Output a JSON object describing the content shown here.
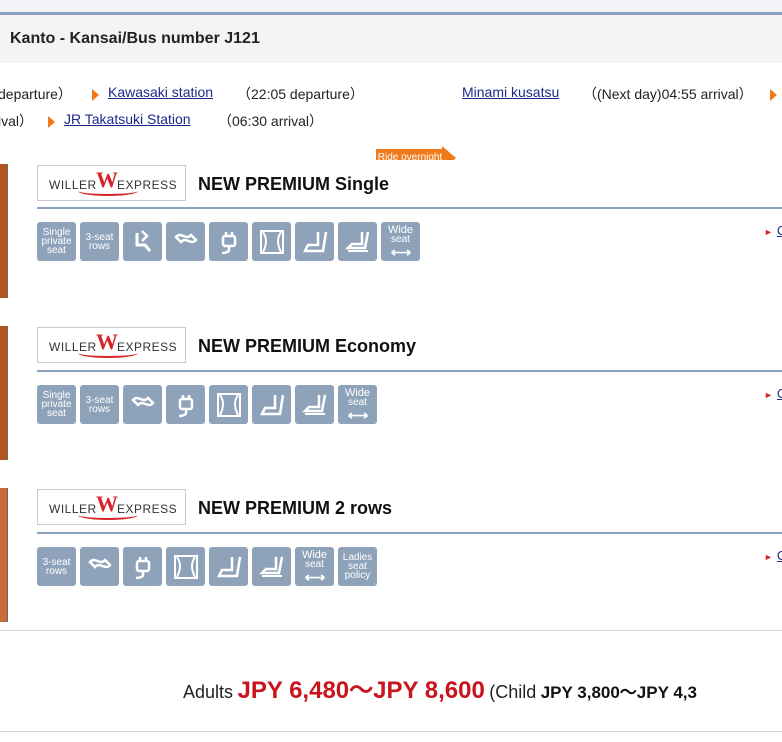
{
  "header": {
    "title": "Kanto - Kansai/Bus number J121"
  },
  "route": {
    "seg1_time": " departure）",
    "stop1": "Kawasaki station",
    "seg2_time": "（22:05 departure）",
    "overnight_label": "Ride overnight",
    "stop2": "Minami kusatsu",
    "seg3_time": "（(Next day)04:55 arrival）",
    "seg4_time": "ival）",
    "stop3": "JR Takatsuki Station",
    "seg5_time": "（06:30 arrival）"
  },
  "logo": {
    "left": "WILLER",
    "mark": "W",
    "right": "EXPRESS"
  },
  "plans": [
    {
      "name": "NEW PREMIUM Single",
      "side_link": "C",
      "icons": [
        {
          "name": "single-private-seat-icon",
          "label": [
            "Single",
            "private",
            "seat"
          ]
        },
        {
          "name": "3-seat-rows-icon",
          "label": [
            "3-seat",
            "rows"
          ]
        },
        {
          "name": "reclining-seat-icon",
          "label": []
        },
        {
          "name": "blanket-icon",
          "label": []
        },
        {
          "name": "power-outlet-icon",
          "label": []
        },
        {
          "name": "curtain-icon",
          "label": []
        },
        {
          "name": "leg-rest-icon",
          "label": []
        },
        {
          "name": "foot-rest-icon",
          "label": []
        },
        {
          "name": "wide-seat-icon",
          "label": [
            "Wide",
            "seat"
          ]
        }
      ]
    },
    {
      "name": "NEW PREMIUM Economy",
      "side_link": "C",
      "icons": [
        {
          "name": "single-private-seat-icon",
          "label": [
            "Single",
            "private",
            "seat"
          ]
        },
        {
          "name": "3-seat-rows-icon",
          "label": [
            "3-seat",
            "rows"
          ]
        },
        {
          "name": "blanket-icon",
          "label": []
        },
        {
          "name": "power-outlet-icon",
          "label": []
        },
        {
          "name": "curtain-icon",
          "label": []
        },
        {
          "name": "leg-rest-icon",
          "label": []
        },
        {
          "name": "foot-rest-icon",
          "label": []
        },
        {
          "name": "wide-seat-icon",
          "label": [
            "Wide",
            "seat"
          ]
        }
      ]
    },
    {
      "name": "NEW PREMIUM 2 rows",
      "side_link": "C",
      "icons": [
        {
          "name": "3-seat-rows-icon",
          "label": [
            "3-seat",
            "rows"
          ]
        },
        {
          "name": "blanket-icon",
          "label": []
        },
        {
          "name": "power-outlet-icon",
          "label": []
        },
        {
          "name": "curtain-icon",
          "label": []
        },
        {
          "name": "leg-rest-icon",
          "label": []
        },
        {
          "name": "foot-rest-icon",
          "label": []
        },
        {
          "name": "wide-seat-icon",
          "label": [
            "Wide",
            "seat"
          ]
        },
        {
          "name": "ladies-seat-policy-icon",
          "label": [
            "Ladies",
            "seat",
            "policy"
          ]
        }
      ]
    }
  ],
  "price": {
    "adults_label": "Adults",
    "adult_range": "JPY 6,480～JPY 8,600",
    "child_open": "(Child",
    "child_range": "JPY 3,800～JPY 4,3"
  },
  "colors": {
    "accent": "#f07a1a",
    "price": "#c8141c",
    "icon_bg": "#8ea3ba",
    "link": "#1b2a8a"
  }
}
